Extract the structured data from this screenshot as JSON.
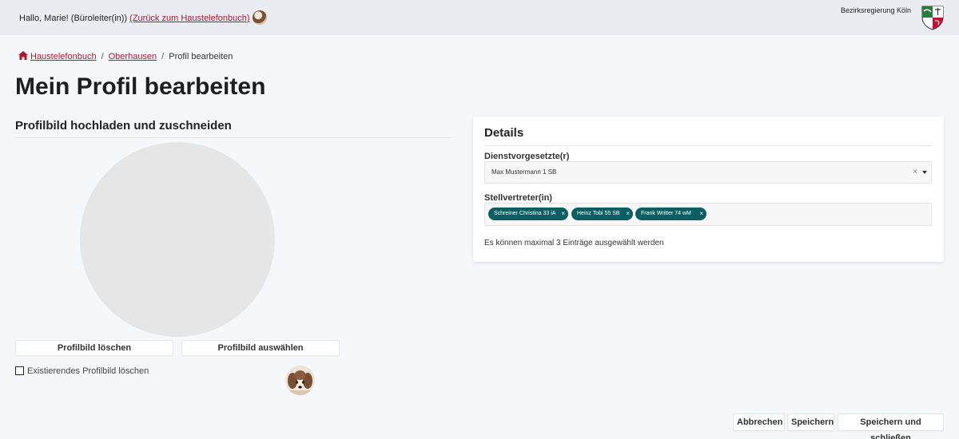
{
  "header": {
    "greeting_prefix": "Hallo, Marie! (Büroleiter(in)) ",
    "back_link": "(Zurück zum Haustelefonbuch)",
    "org_name": "Bezirksregierung Köln",
    "crest_icon": "coat-of-arms-icon"
  },
  "breadcrumb": {
    "home": "Haustelefonbuch",
    "parent": "Oberhausen",
    "current": "Profil bearbeiten",
    "separator": "/"
  },
  "page": {
    "title": "Mein Profil bearbeiten"
  },
  "upload": {
    "title": "Profilbild hochladen und zuschneiden",
    "delete_button": "Profilbild löschen",
    "select_button": "Profilbild auswählen",
    "delete_existing_label": "Existierendes Profilbild löschen",
    "delete_existing_checked": false
  },
  "details": {
    "title": "Details",
    "supervisor_label": "Dienstvorgesetzte(r)",
    "supervisor_value": "Max Mustermann 1 SB",
    "deputy_label": "Stellvertreter(in)",
    "deputies": [
      "Schreiner Christina 33 iA",
      "Heinz Tobi 55 SB",
      "Frank Writter 74 wM"
    ],
    "limit_note": "Es können maximal 3 Einträge ausgewählt werden"
  },
  "footer": {
    "cancel": "Abbrechen",
    "save": "Speichern",
    "save_close": "Speichern und schließen"
  },
  "colors": {
    "accent_red": "#b0192b",
    "tag_teal": "#0b5e63",
    "page_bg": "#f5f8fb",
    "topbar_bg": "#e9edf1"
  }
}
